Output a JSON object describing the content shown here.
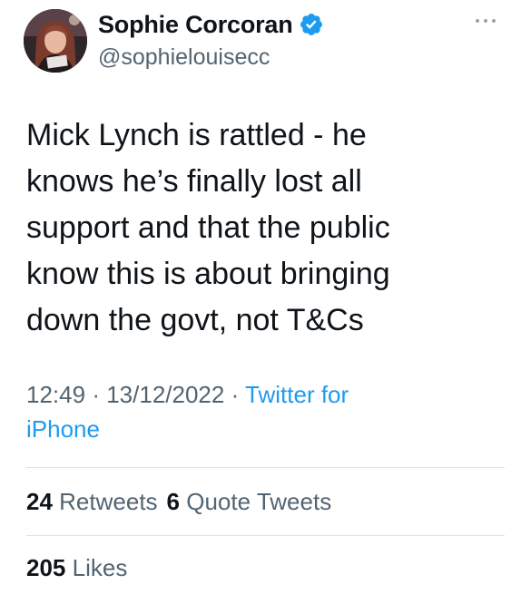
{
  "author": {
    "display_name": "Sophie Corcoran",
    "handle": "@sophielouisecc",
    "verified": true,
    "avatar_icon": "profile-photo"
  },
  "menu": {
    "icon": "more-horizontal-icon"
  },
  "tweet": {
    "text": "Mick Lynch is rattled - he\nknows he’s finally lost all\nsupport and that the public\nknow this is about bringing\ndown the govt, not T&Cs",
    "time": "12:49",
    "separator": "·",
    "date": "13/12/2022",
    "source_line1": "Twitter for",
    "source_line2": "iPhone"
  },
  "engagement": {
    "retweets_count": "24",
    "retweets_label": "Retweets",
    "quote_count": "6",
    "quote_label": "Quote Tweets",
    "likes_count": "205",
    "likes_label": "Likes"
  },
  "colors": {
    "text_primary": "#0f1419",
    "text_secondary": "#536471",
    "accent": "#1d9bf0",
    "divider": "#dfe3e6"
  }
}
